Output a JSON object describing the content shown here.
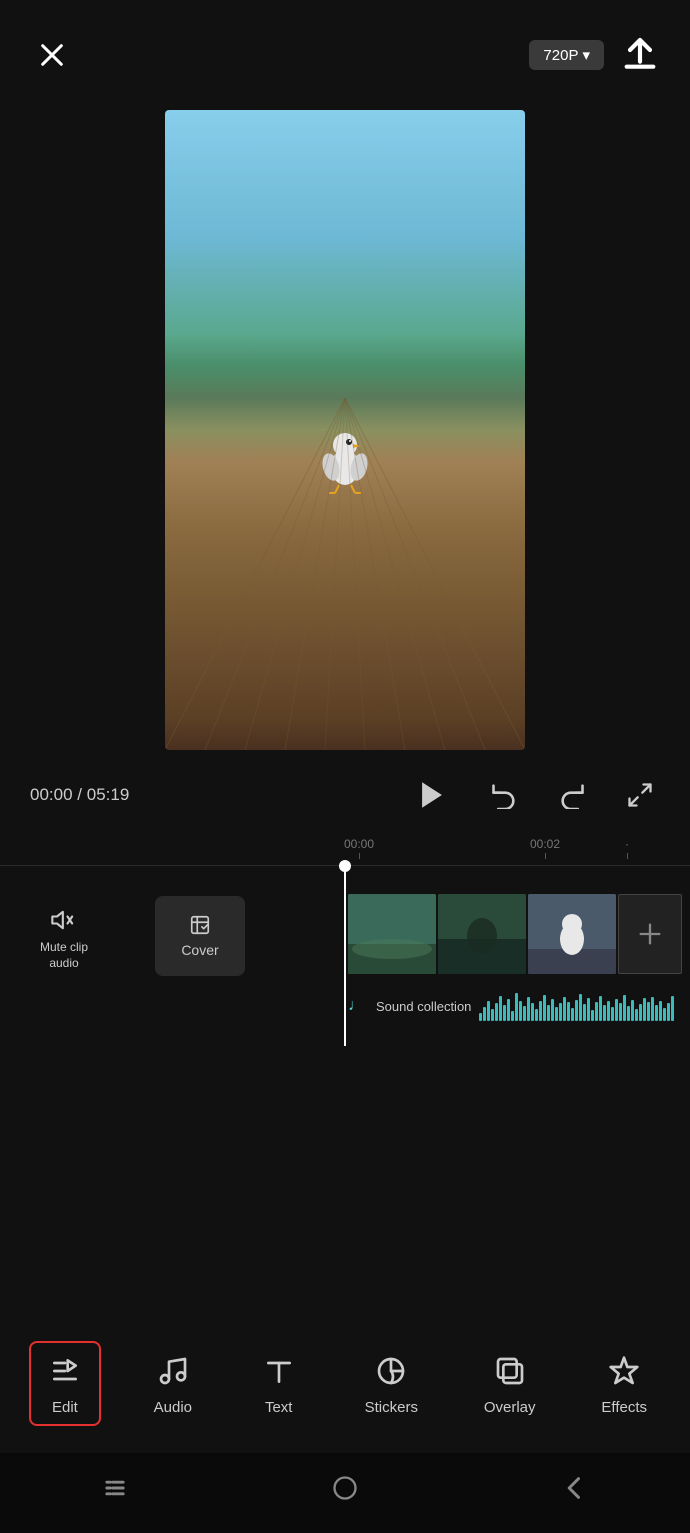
{
  "header": {
    "quality_label": "720P",
    "quality_arrow": "▾"
  },
  "playback": {
    "current_time": "00:00",
    "total_time": "05:19",
    "separator": "/"
  },
  "timeline": {
    "mark_0": "00:00",
    "mark_2": "00:02"
  },
  "clips": {
    "sound_label": "Sound collection"
  },
  "toolbar": {
    "edit_label": "Edit",
    "audio_label": "Audio",
    "text_label": "Text",
    "stickers_label": "Stickers",
    "overlay_label": "Overlay",
    "effects_label": "Effects"
  },
  "mute": {
    "label_line1": "Mute clip",
    "label_line2": "audio"
  },
  "cover": {
    "label": "Cover"
  }
}
